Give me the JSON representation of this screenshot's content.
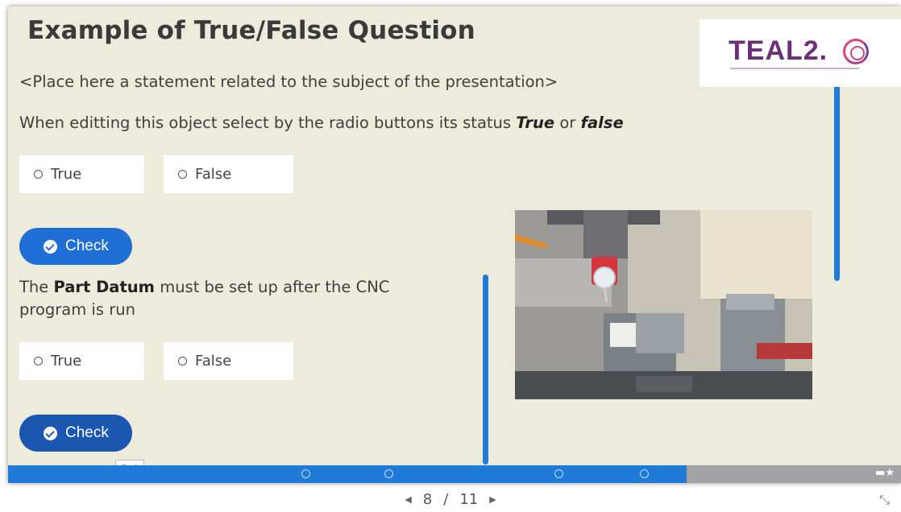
{
  "slide": {
    "title": "Example of True/False Question",
    "statement_placeholder": "<Place here a statement related to the subject of the presentation>",
    "instruction": {
      "text_before": "When editting this object select by the radio buttons its status ",
      "true_word": "True",
      "or_word": " or ",
      "false_word": "false"
    },
    "question1": {
      "option_true": "True",
      "option_false": "False",
      "check_label": "Check"
    },
    "question2": {
      "text_before": "The ",
      "bold": "Part Datum",
      "text_after": " must be set up after the CNC program is run",
      "option_true": "True",
      "option_false": "False",
      "check_label": "Check"
    },
    "tooltip": "Check"
  },
  "logo": {
    "text": "TEAL2."
  },
  "photo": {
    "icon": "cnc-machine-photo"
  },
  "progress": {
    "value": 0.76
  },
  "pager": {
    "current": "8",
    "separator": "/",
    "total": "11"
  },
  "colors": {
    "slide_bg": "#ecebdc",
    "accent_blue": "#1f7ad8",
    "check_button": "#1f6fd6",
    "check_button_dark": "#1b57b0",
    "logo_purple": "#6b2f77"
  }
}
